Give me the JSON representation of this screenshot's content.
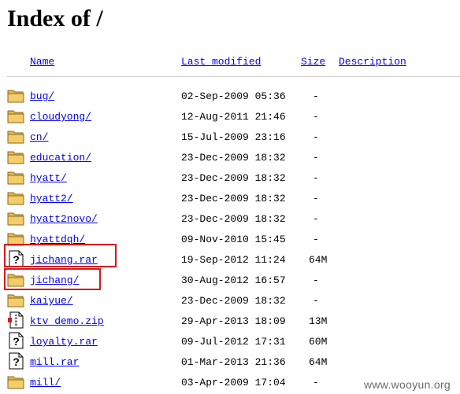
{
  "page": {
    "title": "Index of /"
  },
  "columns": {
    "name": "Name",
    "last_modified": "Last modified",
    "size": "Size",
    "description": "Description"
  },
  "entries": [
    {
      "name": "bug/",
      "date": "02-Sep-2009 05:36",
      "size": "-",
      "icon": "folder-icon"
    },
    {
      "name": "cloudyong/",
      "date": "12-Aug-2011 21:46",
      "size": "-",
      "icon": "folder-icon"
    },
    {
      "name": "cn/",
      "date": "15-Jul-2009 23:16",
      "size": "-",
      "icon": "folder-icon"
    },
    {
      "name": "education/",
      "date": "23-Dec-2009 18:32",
      "size": "-",
      "icon": "folder-icon"
    },
    {
      "name": "hyatt/",
      "date": "23-Dec-2009 18:32",
      "size": "-",
      "icon": "folder-icon"
    },
    {
      "name": "hyatt2/",
      "date": "23-Dec-2009 18:32",
      "size": "-",
      "icon": "folder-icon"
    },
    {
      "name": "hyatt2novo/",
      "date": "23-Dec-2009 18:32",
      "size": "-",
      "icon": "folder-icon"
    },
    {
      "name": "hyattdqh/",
      "date": "09-Nov-2010 15:45",
      "size": "-",
      "icon": "folder-icon"
    },
    {
      "name": "jichang.rar",
      "date": "19-Sep-2012 11:24",
      "size": "64M",
      "icon": "unknown-file-icon"
    },
    {
      "name": "jichang/",
      "date": "30-Aug-2012 16:57",
      "size": "-",
      "icon": "folder-icon"
    },
    {
      "name": "kaiyue/",
      "date": "23-Dec-2009 18:32",
      "size": "-",
      "icon": "folder-icon"
    },
    {
      "name": "ktv_demo.zip",
      "date": "29-Apr-2013 18:09",
      "size": "13M",
      "icon": "compressed-file-icon"
    },
    {
      "name": "loyalty.rar",
      "date": "09-Jul-2012 17:31",
      "size": "60M",
      "icon": "unknown-file-icon"
    },
    {
      "name": "mill.rar",
      "date": "01-Mar-2013 21:36",
      "size": "64M",
      "icon": "unknown-file-icon"
    },
    {
      "name": "mill/",
      "date": "03-Apr-2009 17:04",
      "size": "-",
      "icon": "folder-icon"
    }
  ],
  "watermark": "www.wooyun.org",
  "colors": {
    "link": "#0000ee",
    "highlight": "#d61818",
    "folder": "#e8b84a"
  }
}
